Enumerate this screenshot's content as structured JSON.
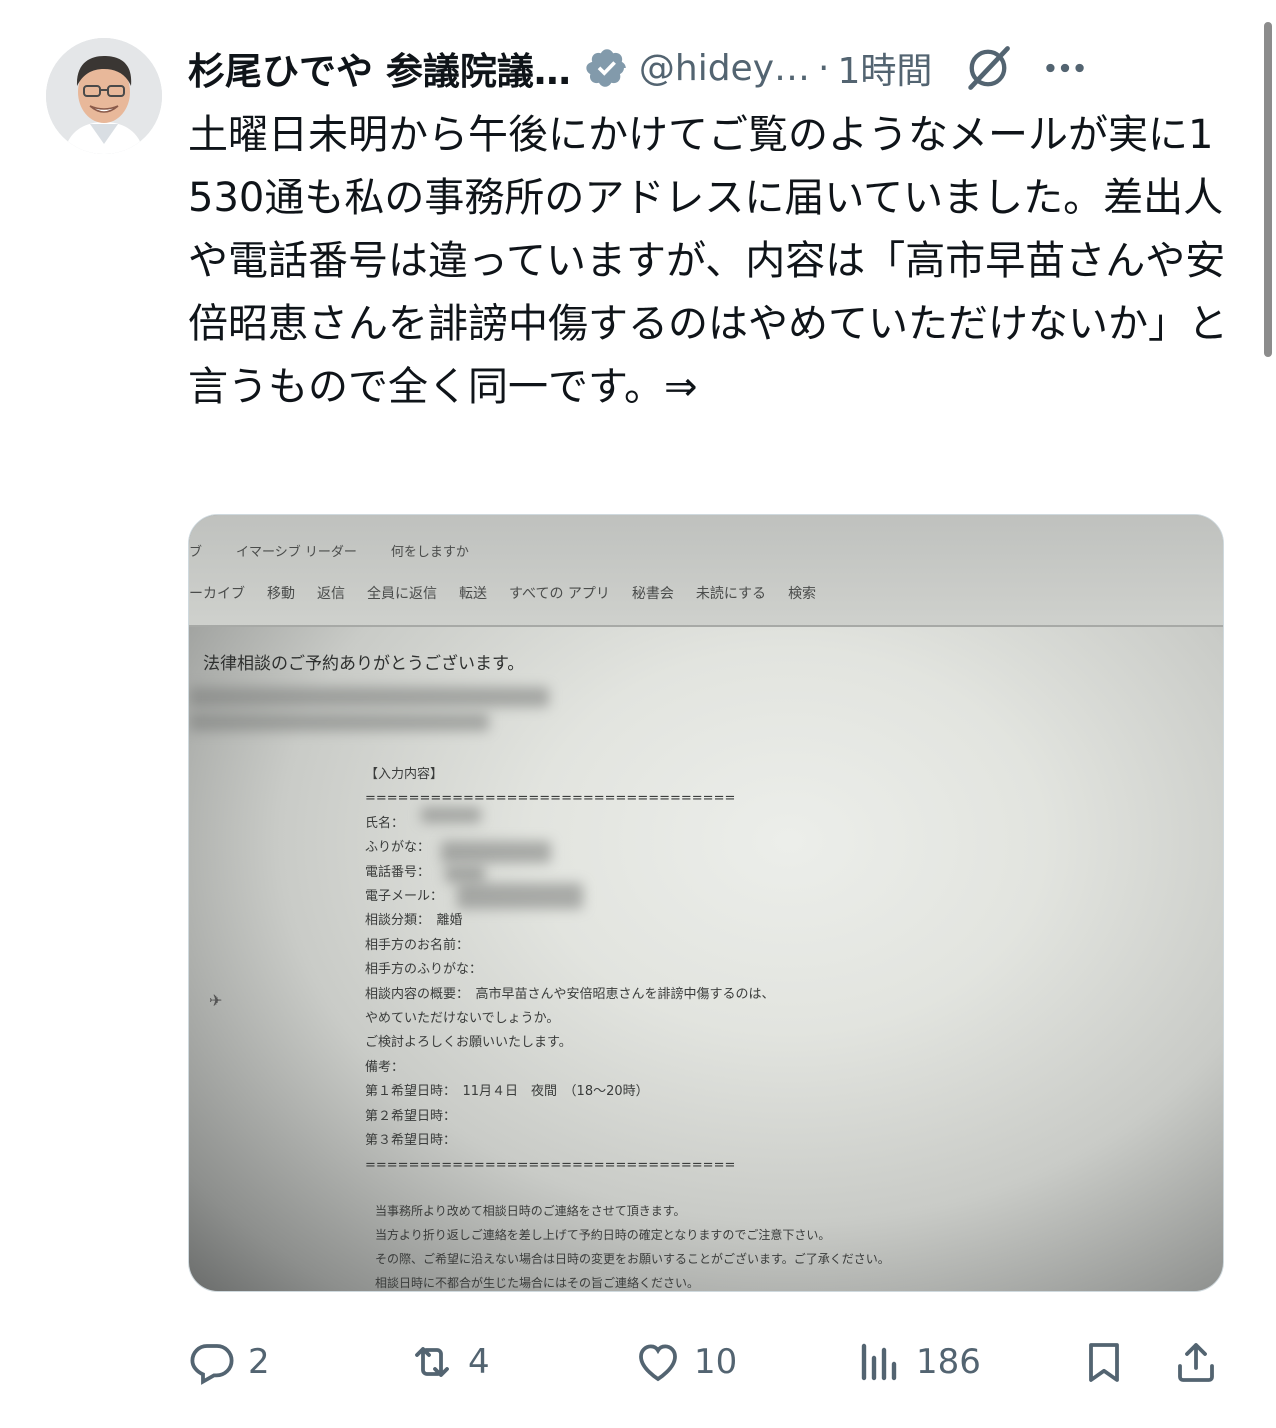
{
  "author": {
    "display_name": "杉尾ひでや 参議院議…",
    "handle": "@hidey…",
    "separator": "·",
    "time": "1時間",
    "verified": true
  },
  "tweet": {
    "text": "土曜日未明から午後にかけてご覧のようなメールが実に1530通も私の事務所のアドレスに届いていました。差出人や電話番号は違っていますが、内容は「高市早苗さんや安倍昭恵さんを誹謗中傷するのはやめていただけないか」と言うもので全く同一です。⇒"
  },
  "media": {
    "ribbon_tabs": [
      "ブ",
      "イマーシブ リーダー",
      "何をしますか"
    ],
    "ribbon_tools": [
      "ーカイブ",
      "移動",
      "返信",
      "全員に返信",
      "転送",
      "すべての アプリ",
      "秘書会",
      "未読にする",
      "検索"
    ],
    "subject": "法律相談のご予約ありがとうございます。",
    "body_lines": [
      "【入力内容】",
      "==================================",
      "氏名：",
      "ふりがな：",
      "電話番号：",
      "電子メール：",
      "相談分類：　離婚",
      "相手方のお名前：",
      "相手方のふりがな：",
      "相談内容の概要：　高市早苗さんや安倍昭恵さんを誹謗中傷するのは、",
      "やめていただけないでしょうか。",
      "ご検討よろしくお願いいたします。",
      "備考：",
      "第１希望日時：　11月４日　夜間　（18〜20時）",
      "第２希望日時：",
      "第３希望日時：",
      "=================================="
    ],
    "footer_lines": [
      "当事務所より改めて相談日時のご連絡をさせて頂きます。",
      "当方より折り返しご連絡を差し上げて予約日時の確定となりますのでご注意下さい。",
      "その際、ご希望に沿えない場合は日時の変更をお願いすることがございます。ご了承ください。",
      "相談日時に不都合が生じた場合にはその旨ご連絡ください。"
    ]
  },
  "actions": {
    "replies": "2",
    "reposts": "4",
    "likes": "10",
    "views": "186"
  },
  "icons": {
    "avatar": "profile-photo",
    "verified": "verified-badge-icon",
    "grok": "grok-icon",
    "more": "more-icon",
    "reply": "reply-icon",
    "repost": "repost-icon",
    "like": "heart-icon",
    "views": "views-icon",
    "bookmark": "bookmark-icon",
    "share": "share-icon"
  },
  "colors": {
    "text": "#0f1419",
    "secondary": "#536471",
    "verified_badge": "#829aab"
  }
}
